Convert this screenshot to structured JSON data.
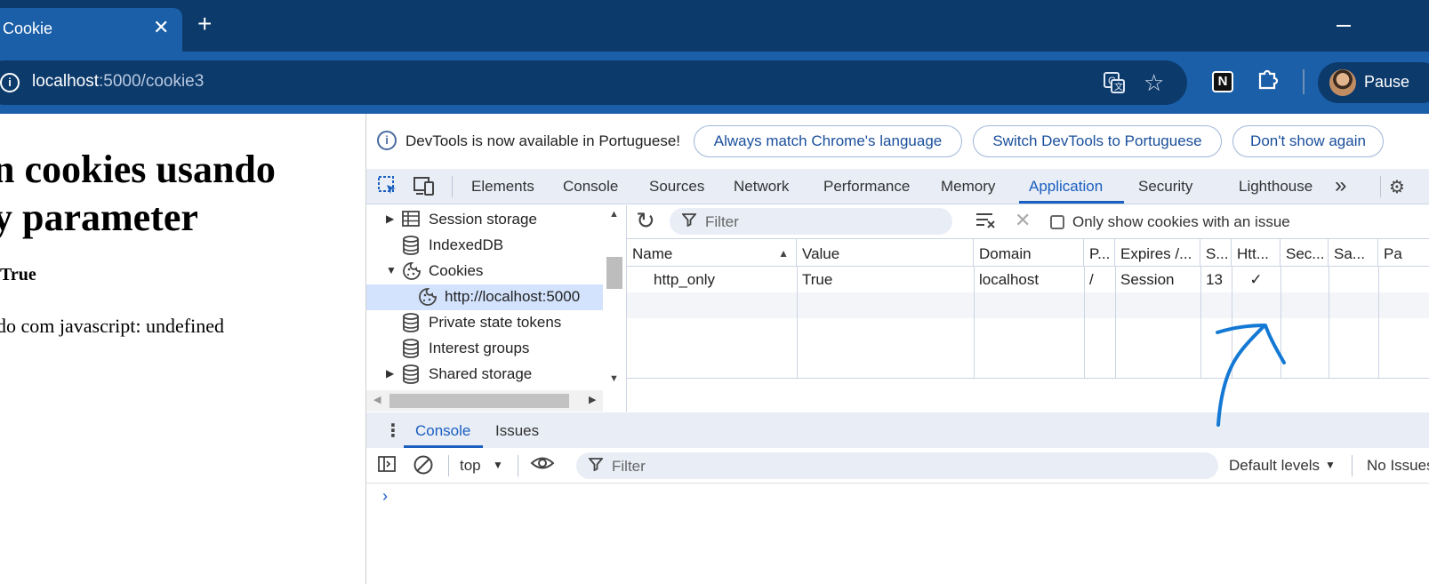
{
  "browser": {
    "tab_title": "Cookie",
    "tab_close": "✕",
    "new_tab": "+",
    "url_host": "localhost",
    "url_rest": ":5000/cookie3",
    "profile_name": "Pause"
  },
  "page": {
    "heading_line1": "n cookies usando",
    "heading_line2": "y parameter",
    "bold_line": "True",
    "plain_line": "do com javascript: undefined"
  },
  "devtools": {
    "infobar": {
      "message": "DevTools is now available in Portuguese!",
      "btn_match": "Always match Chrome's language",
      "btn_switch": "Switch DevTools to Portuguese",
      "btn_dismiss": "Don't show again"
    },
    "tabs": [
      "Elements",
      "Console",
      "Sources",
      "Network",
      "Performance",
      "Memory",
      "Application",
      "Security",
      "Lighthouse"
    ],
    "more_tabs": "»",
    "tree": [
      {
        "label": "Session storage",
        "arrow": "▶",
        "icon": "grid-icon"
      },
      {
        "label": "IndexedDB",
        "arrow": "",
        "icon": "database-icon"
      },
      {
        "label": "Cookies",
        "arrow": "▼",
        "icon": "cookie-icon"
      },
      {
        "label": "http://localhost:5000",
        "arrow": "",
        "icon": "cookie-icon",
        "selected": true
      },
      {
        "label": "Private state tokens",
        "arrow": "",
        "icon": "database-icon"
      },
      {
        "label": "Interest groups",
        "arrow": "",
        "icon": "database-icon"
      },
      {
        "label": "Shared storage",
        "arrow": "▶",
        "icon": "database-icon"
      }
    ],
    "cookie_filter_placeholder": "Filter",
    "only_issues_label": "Only show cookies with an issue",
    "table": {
      "headers": [
        "Name",
        "Value",
        "Domain",
        "P...",
        "Expires /...",
        "S...",
        "Htt...",
        "Sec...",
        "Sa...",
        "Pa"
      ],
      "rows": [
        [
          "http_only",
          "True",
          "localhost",
          "/",
          "Session",
          "13",
          "✓",
          "",
          "",
          ""
        ]
      ]
    },
    "drawer": {
      "tabs": [
        "Console",
        "Issues"
      ],
      "context": "top",
      "filter_placeholder": "Filter",
      "levels": "Default levels",
      "issues": "No Issues",
      "prompt": "›"
    }
  },
  "colors": {
    "chrome_dark": "#0c3a6b",
    "chrome_tab": "#1b5fa8",
    "accent": "#1a5fc0",
    "annotation": "#1479d4"
  }
}
